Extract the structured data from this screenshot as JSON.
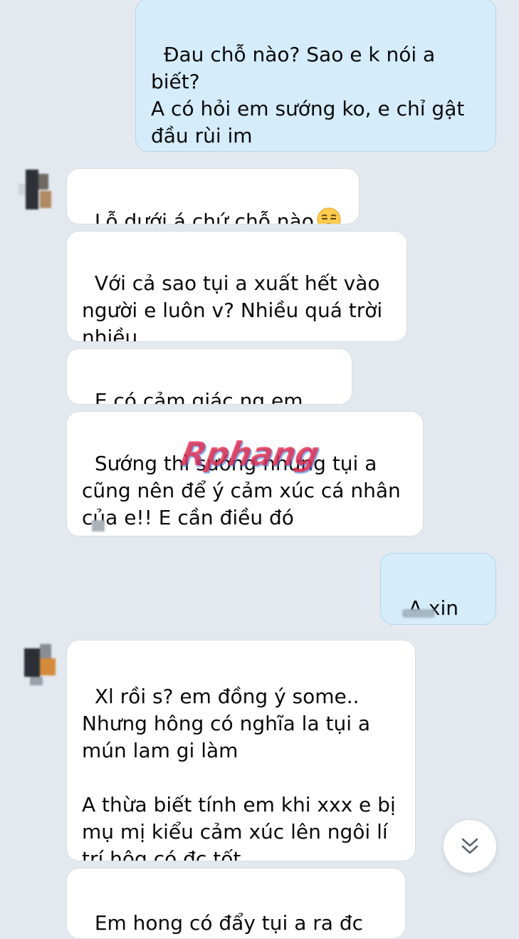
{
  "messages": [
    {
      "id": "m1",
      "dir": "out",
      "text": "Đau chỗ nào? Sao e k nói a biết?\nA có hỏi em sướng ko, e chỉ gật đầu rùi im\nSao a biết đc cơ chứ"
    },
    {
      "id": "m2",
      "dir": "in",
      "text": "Lỗ dưới á chứ chỗ nào",
      "emoji": "unamused-face-emoji"
    },
    {
      "id": "m3",
      "dir": "in",
      "text": "Với cả sao tụi a xuất hết vào người e luôn v? Nhiều quá trời nhiều"
    },
    {
      "id": "m4",
      "dir": "in",
      "text": "E có cảm giác ng em bẩn"
    },
    {
      "id": "m5",
      "dir": "in",
      "text": "Sướng thì sướng nhưng tụi a cũng nên để ý cảm xúc cá nhân của e!! E cần điều đó"
    },
    {
      "id": "m6",
      "dir": "out",
      "text": "A xin lỗi"
    },
    {
      "id": "m7",
      "dir": "in",
      "text": "Xl rồi s? em đồng ý some..\nNhưng hông có nghĩa la tụi a mún lam gi làm\n\nA thừa biết tính em khi xxx e bị mụ mị kiểu cảm xúc lên ngôi lí trí hôg có đc tốt"
    },
    {
      "id": "m8",
      "dir": "in",
      "text": "Em hong có đẩy tụi a ra đc thì"
    }
  ],
  "watermark": "Rphang",
  "scroll_button_icon": "double-chevron-down-icon",
  "colors": {
    "background": "#e3e9ef",
    "outgoing_bubble": "#d5ecfb",
    "incoming_bubble": "#ffffff",
    "text": "#0a0a0a"
  }
}
